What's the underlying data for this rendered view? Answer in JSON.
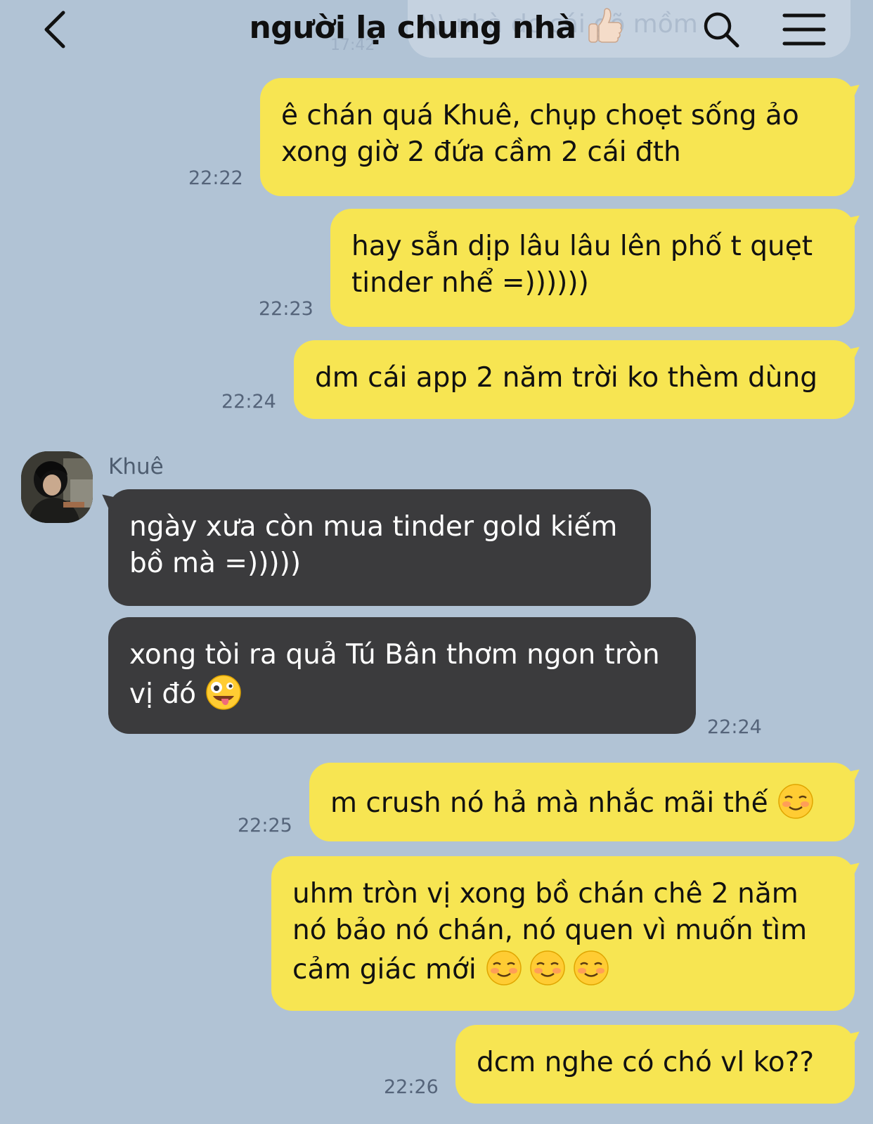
{
  "header": {
    "title": "người lạ chung nhà",
    "title_emoji": "thumbs-up",
    "ghost_preview": "\\\\\\ nhà dc cái gõ mồm",
    "ghost_time": "17:42"
  },
  "colors": {
    "background": "#b1c3d5",
    "my_bubble": "#f7e552",
    "their_bubble": "#3b3b3d",
    "timestamp": "#55647a"
  },
  "contact": {
    "name": "Khuê"
  },
  "messages": [
    {
      "from": "me",
      "text": "ê chán quá Khuê, chụp choẹt sống ảo\nxong giờ 2 đứa cầm 2 cái đth",
      "time": "22:22"
    },
    {
      "from": "me",
      "text": "hay sẵn dịp lâu lâu lên phố t quẹt\ntinder nhể =))))))",
      "time": "22:23"
    },
    {
      "from": "me",
      "text": "dm cái app 2 năm trời ko thèm dùng",
      "time": "22:24"
    },
    {
      "from": "them",
      "text": "ngày xưa còn mua tinder gold kiếm\nbồ mà =)))))",
      "time": ""
    },
    {
      "from": "them",
      "text": "xong tòi ra quả Tú Bân thơm ngon tròn\nvị đó",
      "emoji": "zany-face",
      "time": "22:24"
    },
    {
      "from": "me",
      "text": "m crush nó hả mà nhắc mãi thế",
      "emoji": "smiling-face",
      "time": "22:25"
    },
    {
      "from": "me",
      "text": "uhm tròn vị xong bồ chán chê 2 năm\nnó bảo nó chán, nó quen vì muốn tìm\ncảm giác mới",
      "emoji": "smiling-face x3",
      "time": ""
    },
    {
      "from": "me",
      "text": "dcm nghe có chó vl ko??",
      "time": "22:26"
    }
  ]
}
